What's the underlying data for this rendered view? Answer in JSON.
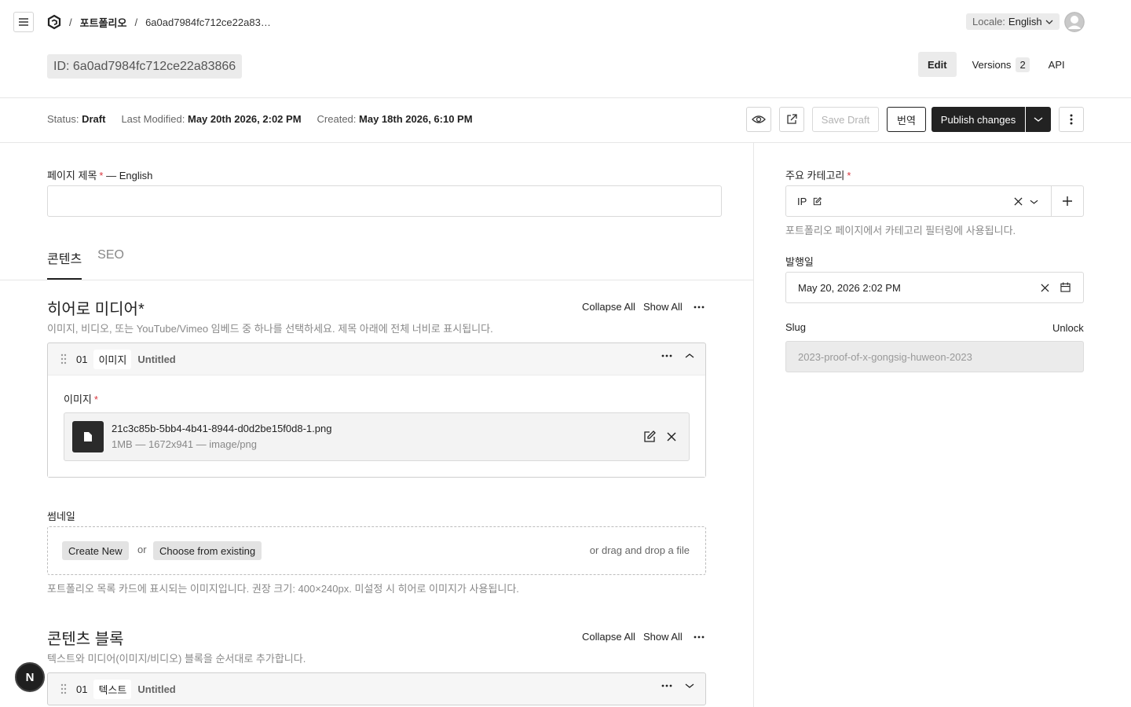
{
  "breadcrumb": {
    "section": "포트폴리오",
    "doc_id": "6a0ad7984fc712ce22a83…",
    "separator": "/"
  },
  "locale": {
    "label": "Locale:",
    "value": "English"
  },
  "document": {
    "id_badge": "ID: 6a0ad7984fc712ce22a83866"
  },
  "doc_tabs": {
    "edit": "Edit",
    "versions": "Versions",
    "versions_count": "2",
    "api": "API"
  },
  "status": {
    "status_label": "Status:",
    "status_value": "Draft",
    "modified_label": "Last Modified:",
    "modified_value": "May 20th 2026, 2:02 PM",
    "created_label": "Created:",
    "created_value": "May 18th 2026, 6:10 PM"
  },
  "actions": {
    "save_draft": "Save Draft",
    "translate": "번역",
    "publish": "Publish changes"
  },
  "page_title_field": {
    "label": "페이지 제목",
    "required": "*",
    "suffix": "— English",
    "value": ""
  },
  "tabs": {
    "content": "콘텐츠",
    "seo": "SEO"
  },
  "hero": {
    "title": "히어로 미디어*",
    "description": "이미지, 비디오, 또는 YouTube/Vimeo 임베드 중 하나를 선택하세요. 제목 아래에 전체 너비로 표시됩니다.",
    "collapse_all": "Collapse All",
    "show_all": "Show All",
    "row": {
      "number": "01",
      "type": "이미지",
      "title": "Untitled"
    },
    "image_label": "이미지",
    "required": "*",
    "file": {
      "name": "21c3c85b-5bb4-4b41-8944-d0d2be15f0d8-1.png",
      "meta": "1MB — 1672x941 — image/png"
    }
  },
  "thumbnail": {
    "label": "썸네일",
    "create_new": "Create New",
    "or": "or",
    "choose_existing": "Choose from existing",
    "drag": "or drag and drop a file",
    "hint": "포트폴리오 목록 카드에 표시되는 이미지입니다. 권장 크기: 400×240px. 미설정 시 히어로 이미지가 사용됩니다."
  },
  "content_blocks": {
    "title": "콘텐츠 블록",
    "description": "텍스트와 미디어(이미지/비디오) 블록을 순서대로 추가합니다.",
    "collapse_all": "Collapse All",
    "show_all": "Show All",
    "row": {
      "number": "01",
      "type": "텍스트",
      "title": "Untitled"
    }
  },
  "sidebar": {
    "category": {
      "label": "주요 카테고리",
      "required": "*",
      "value": "IP",
      "hint": "포트폴리오 페이지에서 카테고리 필터링에 사용됩니다."
    },
    "publish_date": {
      "label": "발행일",
      "value": "May 20, 2026 2:02 PM"
    },
    "slug": {
      "label": "Slug",
      "unlock": "Unlock",
      "value": "2023-proof-of-x-gongsig-huweon-2023"
    }
  },
  "fab": {
    "label": "N"
  }
}
